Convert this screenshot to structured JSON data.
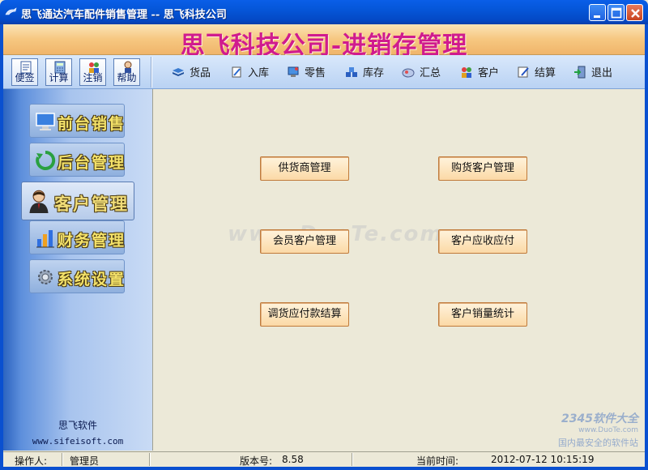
{
  "window": {
    "title": "思飞通达汽车配件销售管理  --  思飞科技公司"
  },
  "banner": {
    "title": "思飞科技公司-进销存管理"
  },
  "quick_buttons": [
    {
      "label": "便签",
      "icon": "note-icon"
    },
    {
      "label": "计算",
      "icon": "calculator-icon"
    },
    {
      "label": "注销",
      "icon": "logout-user-icon"
    },
    {
      "label": "帮助",
      "icon": "help-icon"
    }
  ],
  "nav": [
    {
      "label": "货品",
      "icon": "book-icon"
    },
    {
      "label": "入库",
      "icon": "stock-in-icon"
    },
    {
      "label": "零售",
      "icon": "retail-icon"
    },
    {
      "label": "库存",
      "icon": "inventory-icon"
    },
    {
      "label": "汇总",
      "icon": "summary-icon"
    },
    {
      "label": "客户",
      "icon": "customer-icon"
    },
    {
      "label": "结算",
      "icon": "settlement-icon"
    },
    {
      "label": "退出",
      "icon": "exit-icon"
    }
  ],
  "sidebar": {
    "items": [
      {
        "label": "前台销售",
        "icon": "monitor-icon",
        "active": false
      },
      {
        "label": "后台管理",
        "icon": "recycle-icon",
        "active": false
      },
      {
        "label": "客户管理",
        "icon": "person-icon",
        "active": true
      },
      {
        "label": "财务管理",
        "icon": "bar-chart-icon",
        "active": false
      },
      {
        "label": "系统设置",
        "icon": "gear-icon",
        "active": false
      }
    ],
    "footer_name": "思飞软件",
    "footer_url": "www.sifeisoft.com"
  },
  "main": {
    "buttons": [
      "供货商管理",
      "购货客户管理",
      "会员客户管理",
      "客户应收应付",
      "调货应付款结算",
      "客户销量统计"
    ],
    "watermark": "www.DuoTe.com",
    "corner_wm_top": "2345软件大全",
    "corner_wm_url": "www.DuoTe.com",
    "corner_wm_bottom": "国内最安全的软件站"
  },
  "status": {
    "operator_label": "操作人:",
    "operator_value": "管理员",
    "version_label": "版本号:",
    "version_value": "8.58",
    "time_label": "当前时间:",
    "time_value": "2012-07-12 10:15:19"
  },
  "colors": {
    "titlebar": "#0556d8",
    "banner_text": "#d01b8e",
    "sidebar_text": "#f5e36a"
  }
}
